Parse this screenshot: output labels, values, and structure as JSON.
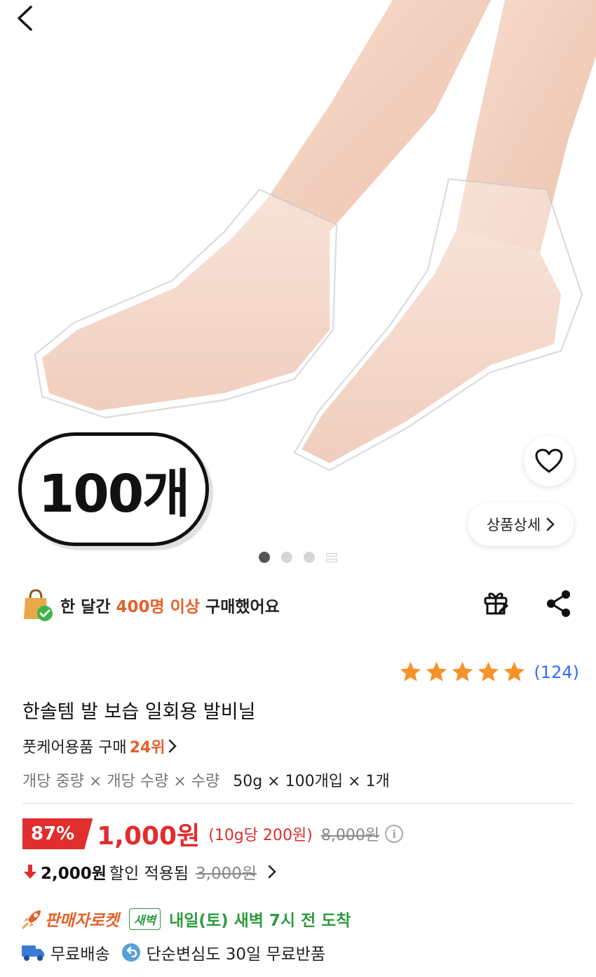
{
  "header": {
    "back_icon": "chevron-left-icon"
  },
  "hero": {
    "quantity_badge": "100개",
    "detail_button": "상품상세",
    "slide_count": 3,
    "active_slide": 1
  },
  "purchase_stat": {
    "prefix": "한 달간",
    "highlight": "400명 이상",
    "suffix": "구매했어요",
    "icon": "shopping-bag-check-icon"
  },
  "actions": {
    "gift_icon": "gift-icon",
    "share_icon": "share-icon"
  },
  "rating": {
    "stars": 5,
    "review_count": "(124)"
  },
  "product": {
    "title": "한솔템 발 보습 일회용 발비닐",
    "rank_prefix": "풋케어용품 구매",
    "rank_value": "24위",
    "spec_label": "개당 중량 × 개당 수량 × 수량",
    "spec_value": "50g × 100개입 × 1개"
  },
  "price": {
    "discount_rate": "87%",
    "sale_price": "1,000원",
    "unit_price": "(10g당 200원)",
    "original_price": "8,000원"
  },
  "coupon": {
    "amount": "2,000원",
    "text": "할인 적용됨",
    "before_price": "3,000원"
  },
  "delivery": {
    "seller_rocket": "판매자로켓",
    "dawn_badge": "새벽",
    "arrival": "내일(토) 새벽 7시 전 도착",
    "free_shipping": "무료배송",
    "free_return": "단순변심도 30일 무료반품"
  },
  "colors": {
    "accent_orange": "#e4612a",
    "price_red": "#e02d2d",
    "link_blue": "#346aff",
    "dawn_green": "#2e9b41",
    "star": "#f5932b"
  }
}
